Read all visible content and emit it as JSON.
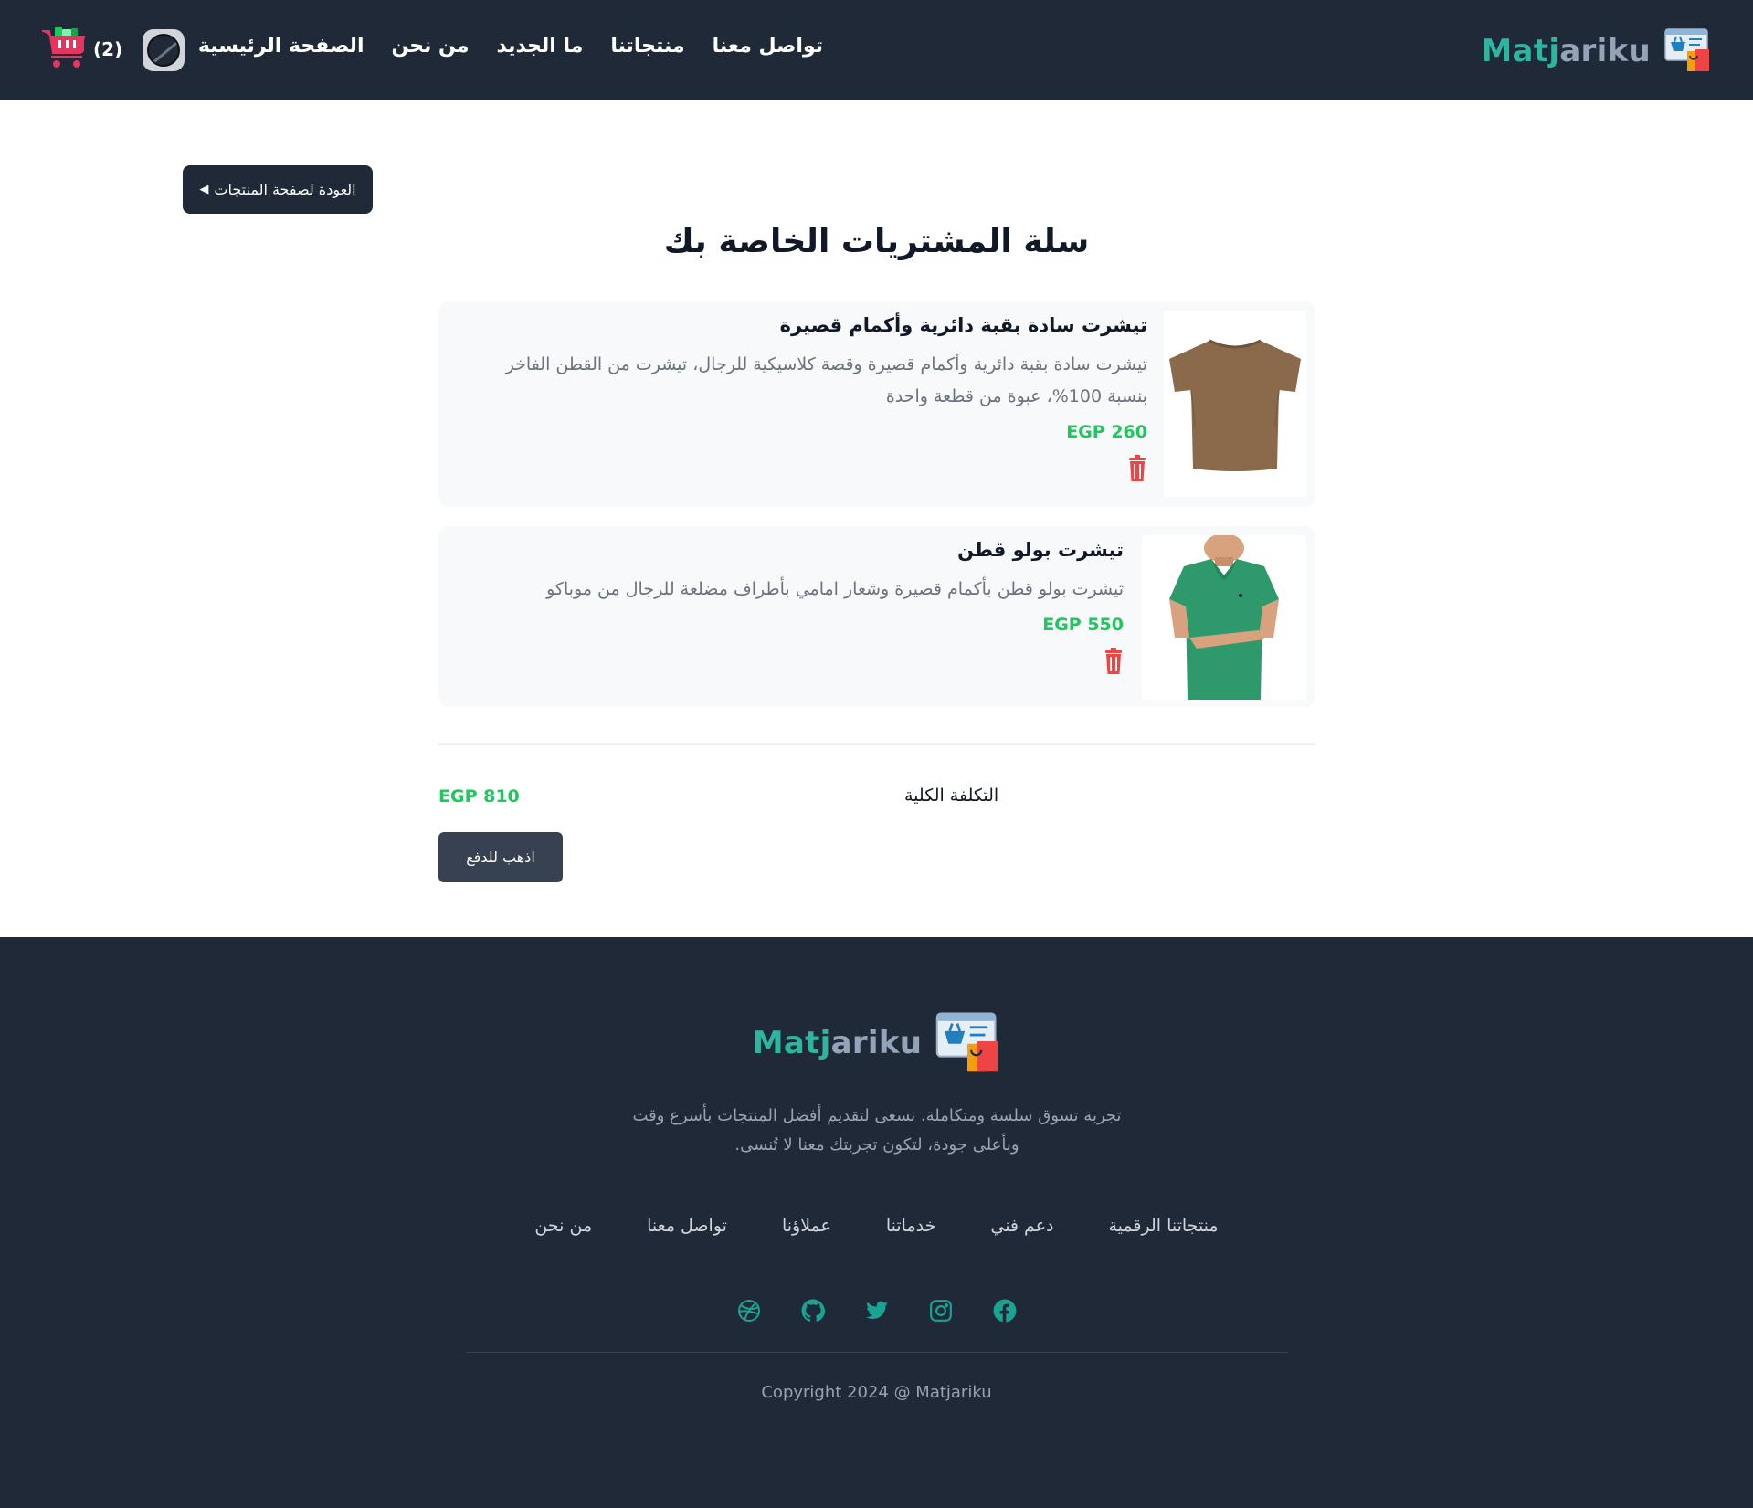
{
  "brand": {
    "name_part1": "Matj",
    "name_part2": "ariku",
    "accent": "#2db5a1",
    "dark_bg": "#1f2937",
    "price_color": "#22c55e"
  },
  "header": {
    "nav": [
      {
        "label": "الصفحة الرئيسية"
      },
      {
        "label": "من نحن"
      },
      {
        "label": "ما الجديد"
      },
      {
        "label": "منتجاتنا"
      },
      {
        "label": "تواصل معنا"
      }
    ],
    "cart_count": "(2)",
    "cart_icon": "shopping-cart-icon",
    "avatar_icon": "user-avatar"
  },
  "main": {
    "back_label": "العودة لصفحة المنتجات",
    "back_arrow": "◀",
    "title": "سلة المشتريات الخاصة بك",
    "items": [
      {
        "title": "تيشرت سادة بقبة دائرية وأكمام قصيرة",
        "description": "تيشرت سادة بقبة دائرية وأكمام قصيرة وقصة كلاسيكية للرجال، تيشرت من القطن الفاخر بنسبة 100%، عبوة من قطعة واحدة",
        "price": "EGP 260",
        "image": "brown-tshirt",
        "color": "#8b6a4c"
      },
      {
        "title": "تيشرت بولو قطن",
        "description": "تيشرت بولو قطن بأكمام قصيرة وشعار امامي بأطراف مضلعة للرجال من موباكو",
        "price": "EGP 550",
        "image": "green-polo-shirt",
        "color": "#2e9a6b"
      }
    ],
    "total_label": "التكلفة الكلية",
    "total_value": "EGP 810",
    "pay_label": "اذهب للدفع"
  },
  "footer": {
    "description": "تجربة تسوق سلسة ومتكاملة. نسعى لتقديم أفضل المنتجات بأسرع وقت وبأعلى جودة، لتكون تجربتك معنا لا تُنسى.",
    "links": [
      {
        "label": "من نحن"
      },
      {
        "label": "تواصل معنا"
      },
      {
        "label": "عملاؤنا"
      },
      {
        "label": "خدماتنا"
      },
      {
        "label": "دعم فني"
      },
      {
        "label": "منتجاتنا الرقمية"
      }
    ],
    "social": [
      "dribbble-icon",
      "github-icon",
      "twitter-icon",
      "instagram-icon",
      "facebook-icon"
    ],
    "copyright": "Copyright 2024 @ Matjariku"
  }
}
